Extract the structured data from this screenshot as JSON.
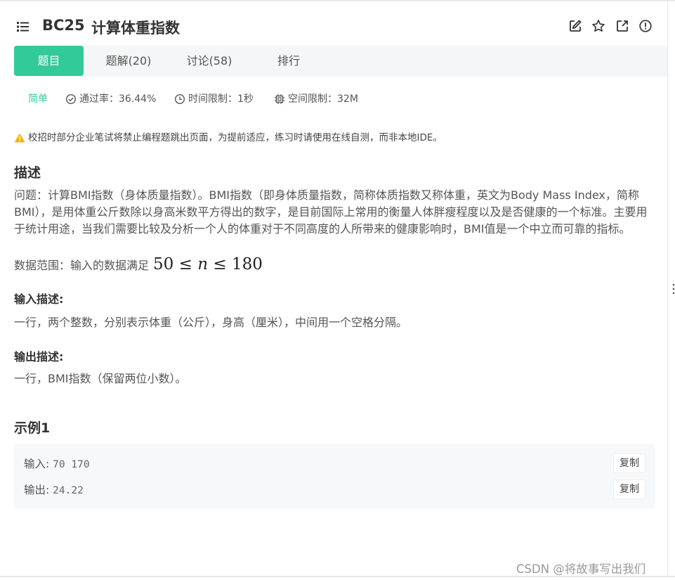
{
  "header": {
    "code": "BC25",
    "title": "计算体重指数",
    "icons": [
      "list-icon",
      "edit-icon",
      "star-icon",
      "share-icon",
      "report-icon"
    ]
  },
  "tabs": [
    {
      "label": "题目",
      "active": true
    },
    {
      "label": "题解(20)",
      "active": false
    },
    {
      "label": "讨论(58)",
      "active": false
    },
    {
      "label": "排行",
      "active": false
    }
  ],
  "meta": {
    "difficulty": "简单",
    "pass_rate": "通过率：36.44%",
    "time_limit": "时间限制：1秒",
    "space_limit": "空间限制：32M"
  },
  "notice": "校招时部分企业笔试将禁止编程题跳出页面，为提前适应，练习时请使用在线自测，而非本地IDE。",
  "description": {
    "heading": "描述",
    "text": "问题：计算BMI指数（身体质量指数）。BMI指数（即身体质量指数，简称体质指数又称体重，英文为Body Mass Index，简称BMI），是用体重公斤数除以身高米数平方得出的数字，是目前国际上常用的衡量人体胖瘦程度以及是否健康的一个标准。主要用于统计用途，当我们需要比较及分析一个人的体重对于不同高度的人所带来的健康影响时，BMI值是一个中立而可靠的指标。",
    "range_label": "数据范围：输入的数据满足",
    "range_low": "50",
    "range_var": "n",
    "range_high": "180",
    "range_op": "≤"
  },
  "input_desc": {
    "heading": "输入描述:",
    "text": "一行，两个整数，分别表示体重（公斤），身高（厘米），中间用一个空格分隔。"
  },
  "output_desc": {
    "heading": "输出描述:",
    "text": "一行，BMI指数（保留两位小数）。"
  },
  "example": {
    "heading": "示例1",
    "input_label": "输入:",
    "input_value": "70 170",
    "output_label": "输出:",
    "output_value": "24.22",
    "copy_label": "复制"
  },
  "watermark": "CSDN @将故事写出我们",
  "colors": {
    "accent": "#32ca99",
    "warning": "#f5b100",
    "text": "#333333"
  }
}
